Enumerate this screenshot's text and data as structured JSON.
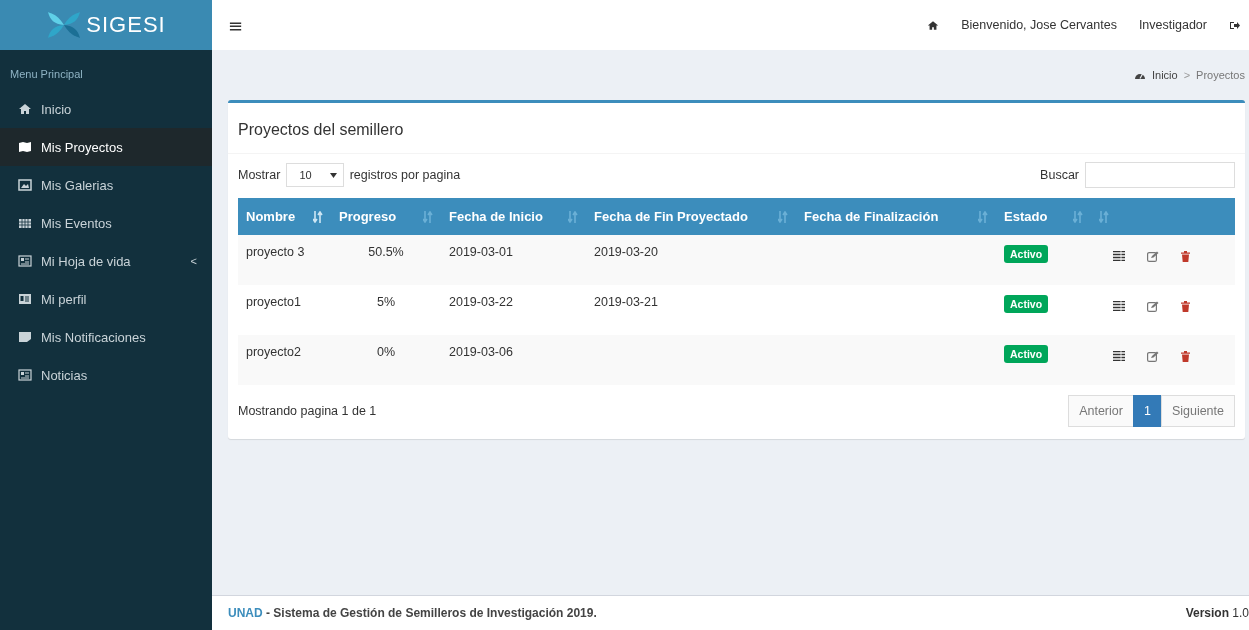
{
  "logo": {
    "text": "SIGESI"
  },
  "sidebar": {
    "header": "Menu Principal",
    "items": [
      {
        "label": "Inicio",
        "kind": "home",
        "selected": false
      },
      {
        "label": "Mis Proyectos",
        "kind": "map",
        "selected": true
      },
      {
        "label": "Mis Galerias",
        "kind": "image",
        "selected": false
      },
      {
        "label": "Mis Eventos",
        "kind": "calendar",
        "selected": false
      },
      {
        "label": "Mi Hoja de vida",
        "kind": "card",
        "selected": false,
        "submenu_marker": "<"
      },
      {
        "label": "Mi perfil",
        "kind": "idcard",
        "selected": false
      },
      {
        "label": "Mis Notificaciones",
        "kind": "note",
        "selected": false
      },
      {
        "label": "Noticias",
        "kind": "card",
        "selected": false
      }
    ]
  },
  "topbar": {
    "menu_glyph": "≡",
    "welcome": "Bienvenido, Jose Cervantes",
    "role": "Investigador"
  },
  "breadcrumb": {
    "separator": ">",
    "items": [
      "Inicio",
      "Proyectos"
    ]
  },
  "panel": {
    "title": "Proyectos del semillero",
    "length": {
      "label_before": "Mostrar",
      "value": "10",
      "label_after": "registros por pagina"
    },
    "search": {
      "label": "Buscar"
    },
    "table": {
      "columns": [
        {
          "label": "Nombre",
          "sorted": true
        },
        {
          "label": "Progreso",
          "sorted": false
        },
        {
          "label": "Fecha de Inicio",
          "sorted": false
        },
        {
          "label": "Fecha de Fin Proyectado",
          "sorted": false
        },
        {
          "label": "Fecha de Finalización",
          "sorted": false
        },
        {
          "label": "Estado",
          "sorted": false
        },
        {
          "sorted": false
        }
      ],
      "rows": [
        {
          "name": "proyecto 3",
          "progress": "50.5%",
          "start": "2019-03-01",
          "planned_end": "2019-03-20",
          "status": "Activo"
        },
        {
          "name": "proyecto1",
          "progress": "5%",
          "start": "2019-03-22",
          "planned_end": "2019-03-21",
          "status": "Activo"
        },
        {
          "name": "proyecto2",
          "progress": "0%",
          "start": "2019-03-06",
          "status": "Activo"
        }
      ]
    },
    "info": "Mostrando pagina 1 de 1",
    "pagination": [
      {
        "label": "Anterior",
        "selected": false
      },
      {
        "label": "1",
        "selected": true
      },
      {
        "label": "Siguiente",
        "selected": false
      }
    ]
  },
  "footer": {
    "brand": "UNAD",
    "text": " - Sistema de Gestión de Semilleros de Investigación 2019.",
    "version_label": "Version",
    "version": "1.0"
  }
}
